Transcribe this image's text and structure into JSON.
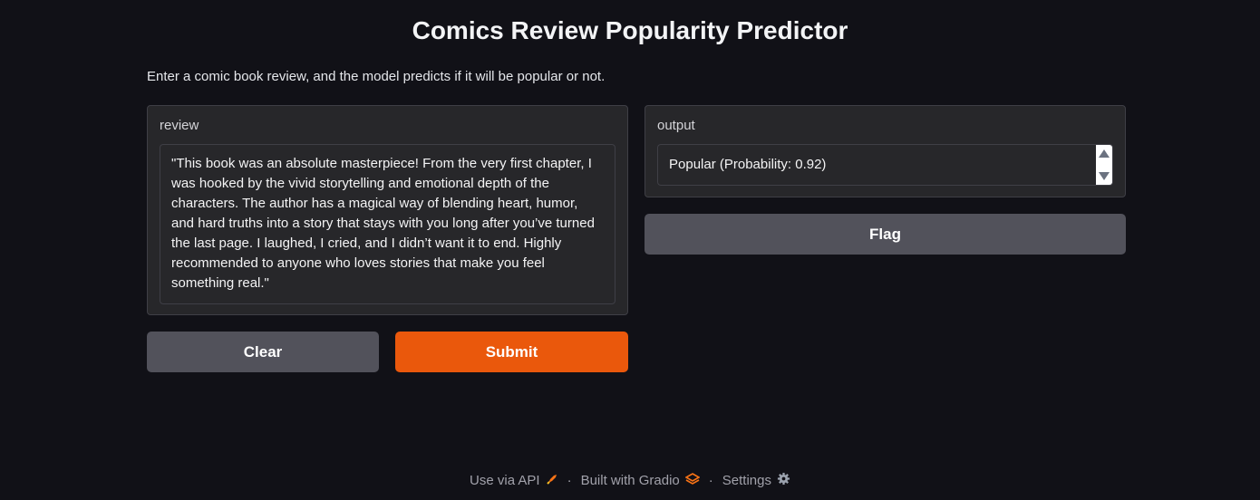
{
  "header": {
    "title": "Comics Review Popularity Predictor",
    "description": "Enter a comic book review, and the model predicts if it will be popular or not."
  },
  "inputs": {
    "review_label": "review",
    "review_value": "\"This book was an absolute masterpiece! From the very first chapter, I was hooked by the vivid storytelling and emotional depth of the characters. The author has a magical way of blending heart, humor, and hard truths into a story that stays with you long after you’ve turned the last page. I laughed, I cried, and I didn’t want it to end. Highly recommended to anyone who loves stories that make you feel something real.\""
  },
  "outputs": {
    "output_label": "output",
    "output_value": "Popular (Probability: 0.92)"
  },
  "buttons": {
    "clear": "Clear",
    "submit": "Submit",
    "flag": "Flag"
  },
  "footer": {
    "api": "Use via API",
    "built": "Built with Gradio",
    "settings": "Settings",
    "separator": "·",
    "icons": [
      "rocket-icon",
      "gradio-logo-icon",
      "gear-icon"
    ]
  },
  "colors": {
    "primary": "#ea580c",
    "secondary": "#52525b",
    "background": "#111117"
  }
}
